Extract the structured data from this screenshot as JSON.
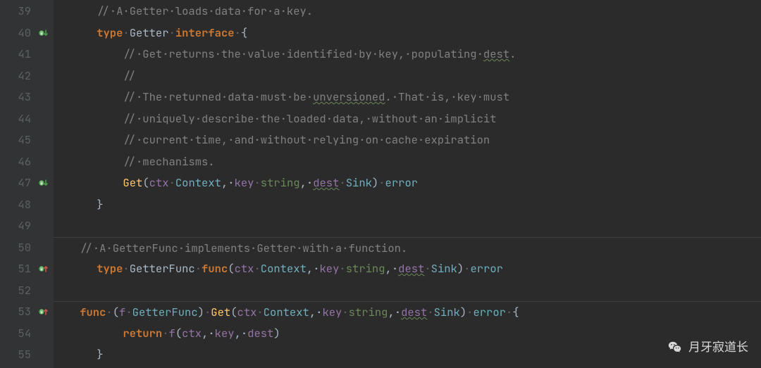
{
  "line_start": 39,
  "line_end": 55,
  "gutter_markers": {
    "40": "impl-down",
    "47": "impl-down",
    "51": "impl-up",
    "53": "impl-up"
  },
  "lines": {
    "l39": {
      "indent": 1,
      "tokens": [
        {
          "t": "// A Getter loads data for a key.",
          "cls": "c"
        }
      ]
    },
    "l40": {
      "indent": 1,
      "tokens": [
        {
          "t": "type",
          "cls": "kw"
        },
        {
          "t": " ",
          "cls": "dot",
          "asDots": 1
        },
        {
          "t": "Getter",
          "cls": "ty"
        },
        {
          "t": " ",
          "cls": "dot",
          "asDots": 1
        },
        {
          "t": "interface",
          "cls": "kw"
        },
        {
          "t": " ",
          "cls": "dot",
          "asDots": 1
        },
        {
          "t": "{",
          "cls": "p"
        }
      ]
    },
    "l41": {
      "indent": 2,
      "tokens": [
        {
          "t": "// Get returns the value identified by key, populating ",
          "cls": "c"
        },
        {
          "t": "dest",
          "cls": "c",
          "wavy": true
        },
        {
          "t": ".",
          "cls": "c"
        }
      ]
    },
    "l42": {
      "indent": 2,
      "tokens": [
        {
          "t": "//",
          "cls": "c"
        }
      ]
    },
    "l43": {
      "indent": 2,
      "tokens": [
        {
          "t": "// The returned data must be ",
          "cls": "c"
        },
        {
          "t": "unversioned",
          "cls": "c",
          "wavy": true
        },
        {
          "t": ". That is, key must",
          "cls": "c"
        }
      ]
    },
    "l44": {
      "indent": 2,
      "tokens": [
        {
          "t": "// uniquely describe the loaded data, without an implicit",
          "cls": "c"
        }
      ]
    },
    "l45": {
      "indent": 2,
      "tokens": [
        {
          "t": "// current time, and without relying on cache expiration",
          "cls": "c"
        }
      ]
    },
    "l46": {
      "indent": 2,
      "tokens": [
        {
          "t": "// mechanisms.",
          "cls": "c"
        }
      ]
    },
    "l47": {
      "indent": 2,
      "tokens": [
        {
          "t": "Get",
          "cls": "fnm"
        },
        {
          "t": "(",
          "cls": "p"
        },
        {
          "t": "ctx",
          "cls": "id"
        },
        {
          "t": " ",
          "cls": "dot",
          "asDots": 1
        },
        {
          "t": "Context",
          "cls": "typ2"
        },
        {
          "t": ", ",
          "cls": "p"
        },
        {
          "t": "key",
          "cls": "id"
        },
        {
          "t": " ",
          "cls": "dot",
          "asDots": 1
        },
        {
          "t": "string",
          "cls": "str"
        },
        {
          "t": ", ",
          "cls": "p"
        },
        {
          "t": "dest",
          "cls": "id",
          "wavy": true
        },
        {
          "t": " ",
          "cls": "dot",
          "asDots": 1
        },
        {
          "t": "Sink",
          "cls": "typ2"
        },
        {
          "t": ")",
          "cls": "p"
        },
        {
          "t": " ",
          "cls": "dot",
          "asDots": 1
        },
        {
          "t": "error",
          "cls": "typ2"
        }
      ]
    },
    "l48": {
      "indent": 1,
      "tokens": [
        {
          "t": "}",
          "cls": "p"
        }
      ]
    },
    "l49": {
      "indent": 0,
      "tokens": []
    },
    "l50": {
      "indent": 1,
      "sep": true,
      "tokens": [
        {
          "t": "// A ",
          "cls": "c"
        },
        {
          "t": "GetterFunc",
          "cls": "c"
        },
        {
          "t": " implements Getter with a function.",
          "cls": "c"
        }
      ]
    },
    "l51": {
      "indent": 1,
      "tokens": [
        {
          "t": "type",
          "cls": "kw"
        },
        {
          "t": " ",
          "cls": "dot",
          "asDots": 1
        },
        {
          "t": "GetterFunc",
          "cls": "ty"
        },
        {
          "t": " ",
          "cls": "dot",
          "asDots": 1
        },
        {
          "t": "func",
          "cls": "kw"
        },
        {
          "t": "(",
          "cls": "p"
        },
        {
          "t": "ctx",
          "cls": "id"
        },
        {
          "t": " ",
          "cls": "dot",
          "asDots": 1
        },
        {
          "t": "Context",
          "cls": "typ2"
        },
        {
          "t": ", ",
          "cls": "p"
        },
        {
          "t": "key",
          "cls": "id"
        },
        {
          "t": " ",
          "cls": "dot",
          "asDots": 1
        },
        {
          "t": "string",
          "cls": "str"
        },
        {
          "t": ", ",
          "cls": "p"
        },
        {
          "t": "dest",
          "cls": "id",
          "wavy": true
        },
        {
          "t": " ",
          "cls": "dot",
          "asDots": 1
        },
        {
          "t": "Sink",
          "cls": "typ2"
        },
        {
          "t": ")",
          "cls": "p"
        },
        {
          "t": " ",
          "cls": "dot",
          "asDots": 1
        },
        {
          "t": "error",
          "cls": "typ2"
        }
      ]
    },
    "l52": {
      "indent": 0,
      "tokens": []
    },
    "l53": {
      "indent": 1,
      "sep": true,
      "tokens": [
        {
          "t": "func",
          "cls": "kw"
        },
        {
          "t": " ",
          "cls": "dot",
          "asDots": 1
        },
        {
          "t": "(",
          "cls": "p"
        },
        {
          "t": "f",
          "cls": "id"
        },
        {
          "t": " ",
          "cls": "dot",
          "asDots": 1
        },
        {
          "t": "GetterFunc",
          "cls": "typ2"
        },
        {
          "t": ")",
          "cls": "p"
        },
        {
          "t": " ",
          "cls": "dot",
          "asDots": 1
        },
        {
          "t": "Get",
          "cls": "fnm"
        },
        {
          "t": "(",
          "cls": "p"
        },
        {
          "t": "ctx",
          "cls": "id"
        },
        {
          "t": " ",
          "cls": "dot",
          "asDots": 1
        },
        {
          "t": "Context",
          "cls": "typ2"
        },
        {
          "t": ", ",
          "cls": "p"
        },
        {
          "t": "key",
          "cls": "id"
        },
        {
          "t": " ",
          "cls": "dot",
          "asDots": 1
        },
        {
          "t": "string",
          "cls": "str"
        },
        {
          "t": ", ",
          "cls": "p"
        },
        {
          "t": "dest",
          "cls": "id",
          "wavy": true
        },
        {
          "t": " ",
          "cls": "dot",
          "asDots": 1
        },
        {
          "t": "Sink",
          "cls": "typ2"
        },
        {
          "t": ")",
          "cls": "p"
        },
        {
          "t": " ",
          "cls": "dot",
          "asDots": 1
        },
        {
          "t": "error",
          "cls": "typ2"
        },
        {
          "t": " ",
          "cls": "dot",
          "asDots": 1
        },
        {
          "t": "{",
          "cls": "p"
        }
      ]
    },
    "l54": {
      "indent": 2,
      "tokens": [
        {
          "t": "return",
          "cls": "kw"
        },
        {
          "t": " ",
          "cls": "dot",
          "asDots": 1
        },
        {
          "t": "f",
          "cls": "id"
        },
        {
          "t": "(",
          "cls": "p"
        },
        {
          "t": "ctx",
          "cls": "id"
        },
        {
          "t": ", ",
          "cls": "p"
        },
        {
          "t": "key",
          "cls": "id"
        },
        {
          "t": ", ",
          "cls": "p"
        },
        {
          "t": "dest",
          "cls": "id"
        },
        {
          "t": ")",
          "cls": "p"
        }
      ]
    },
    "l55": {
      "indent": 1,
      "tokens": [
        {
          "t": "}",
          "cls": "p"
        }
      ]
    }
  },
  "watermark": "月牙寂道长",
  "colors": {
    "background": "#2b2b2b",
    "gutter_bg": "#313335",
    "comment": "#808080",
    "keyword": "#cc7832",
    "function": "#ffc66d",
    "identifier": "#9373a5",
    "type": "#6fafbd",
    "string": "#6a8759"
  }
}
